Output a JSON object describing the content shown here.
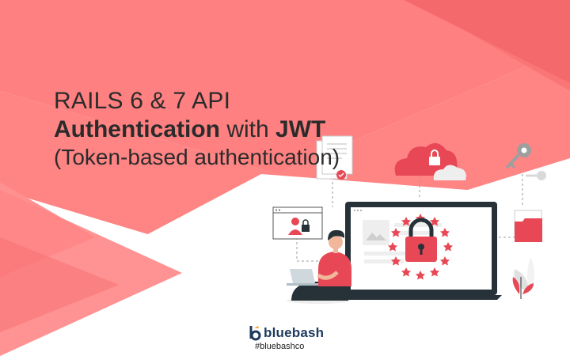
{
  "title": {
    "line1": "RAILS 6 & 7 API",
    "line2_bold_a": "Authentication",
    "line2_mid": " with ",
    "line2_bold_b": "JWT",
    "line3": "(Token-based authentication)"
  },
  "brand": {
    "name": "bluebash",
    "tag": "#bluebashco"
  },
  "colors": {
    "coral": "#ff7b7b",
    "coral_dark": "#f26264",
    "accent": "#e84855",
    "navy": "#263238"
  },
  "icons": [
    "cloud-lock-icon",
    "key-icon",
    "document-icon",
    "folder-icon",
    "browser-lock-icon",
    "laptop-icon",
    "padlock-icon",
    "person-icon",
    "plant-icon",
    "stars-ring-icon"
  ]
}
